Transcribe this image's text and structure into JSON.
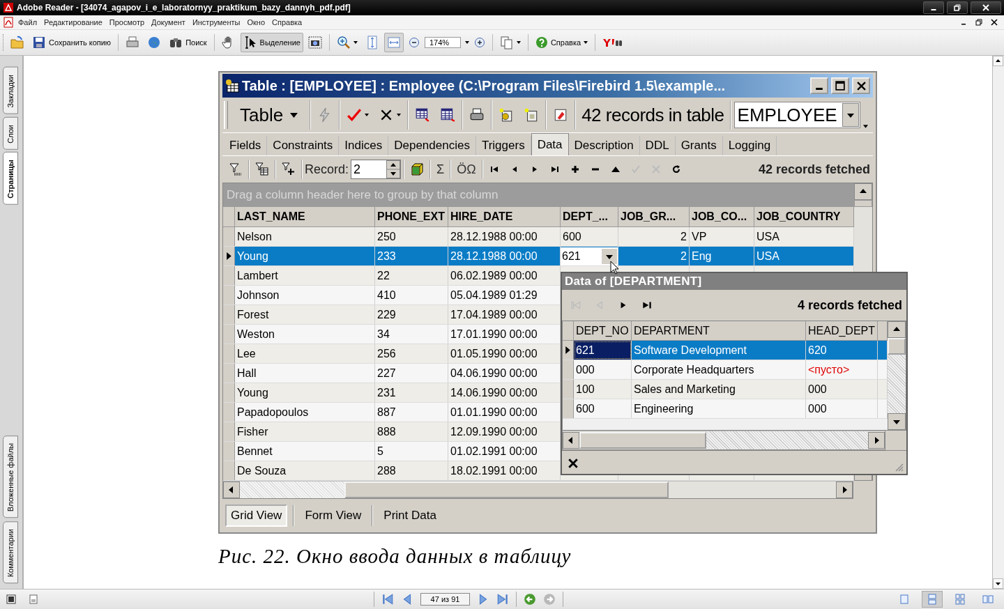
{
  "window": {
    "title": "Adobe Reader - [34074_agapov_i_e_laboratornyy_praktikum_bazy_dannyh_pdf.pdf]"
  },
  "menu": [
    "Файл",
    "Редактирование",
    "Просмотр",
    "Документ",
    "Инструменты",
    "Окно",
    "Справка"
  ],
  "toolbar": {
    "save_copy": "Сохранить копию",
    "search": "Поиск",
    "select_tool": {
      "label": "Выделение",
      "selected": true
    },
    "fit_width": {
      "selected": true
    },
    "zoom": "174%",
    "help": "Справка"
  },
  "side_tabs": [
    {
      "label": "Закладки",
      "selected": false
    },
    {
      "label": "Слои",
      "selected": false
    },
    {
      "label": "Страницы",
      "selected": true
    }
  ],
  "side_tabs_lower": [
    {
      "label": "Вложенные файлы",
      "selected": false
    },
    {
      "label": "Комментарии",
      "selected": false
    }
  ],
  "figure": {
    "title": "Table : [EMPLOYEE] : Employee (C:\\Program Files\\Firebird 1.5\\example...",
    "menu_button": "Table",
    "record_count": "42 records in table",
    "object_combo": "EMPLOYEE",
    "tabs": [
      {
        "label": "Fields",
        "selected": false
      },
      {
        "label": "Constraints",
        "selected": false
      },
      {
        "label": "Indices",
        "selected": false
      },
      {
        "label": "Dependencies",
        "selected": false
      },
      {
        "label": "Triggers",
        "selected": false
      },
      {
        "label": "Data",
        "selected": true
      },
      {
        "label": "Description",
        "selected": false
      },
      {
        "label": "DDL",
        "selected": false
      },
      {
        "label": "Grants",
        "selected": false
      },
      {
        "label": "Logging",
        "selected": false
      }
    ],
    "record_label": "Record:",
    "record_value": "2",
    "sum_symbol": "Σ",
    "charset_symbol": "ÖΩ",
    "fetched": "42 records fetched",
    "group_hint": "Drag a column header here to group by that column",
    "columns": [
      "LAST_NAME",
      "PHONE_EXT",
      "HIRE_DATE",
      "DEPT_...",
      "JOB_GR...",
      "JOB_CO...",
      "JOB_COUNTRY"
    ],
    "rows": [
      {
        "cells": [
          "Nelson",
          "250",
          "28.12.1988 00:00",
          "600",
          "2",
          "VP",
          "USA"
        ],
        "selected": false
      },
      {
        "cells": [
          "Young",
          "233",
          "28.12.1988 00:00",
          "621",
          "2",
          "Eng",
          "USA"
        ],
        "selected": true
      },
      {
        "cells": [
          "Lambert",
          "22",
          "06.02.1989 00:00"
        ],
        "selected": false
      },
      {
        "cells": [
          "Johnson",
          "410",
          "05.04.1989 01:29"
        ],
        "selected": false
      },
      {
        "cells": [
          "Forest",
          "229",
          "17.04.1989 00:00"
        ],
        "selected": false
      },
      {
        "cells": [
          "Weston",
          "34",
          "17.01.1990 00:00"
        ],
        "selected": false
      },
      {
        "cells": [
          "Lee",
          "256",
          "01.05.1990 00:00"
        ],
        "selected": false
      },
      {
        "cells": [
          "Hall",
          "227",
          "04.06.1990 00:00"
        ],
        "selected": false
      },
      {
        "cells": [
          "Young",
          "231",
          "14.06.1990 00:00"
        ],
        "selected": false
      },
      {
        "cells": [
          "Papadopoulos",
          "887",
          "01.01.1990 00:00"
        ],
        "selected": false
      },
      {
        "cells": [
          "Fisher",
          "888",
          "12.09.1990 00:00"
        ],
        "selected": false
      },
      {
        "cells": [
          "Bennet",
          "5",
          "01.02.1991 00:00"
        ],
        "selected": false
      },
      {
        "cells": [
          "De Souza",
          "288",
          "18.02.1991 00:00"
        ],
        "selected": false
      }
    ],
    "lookup": {
      "title": "Data of [DEPARTMENT]",
      "fetched": "4 records fetched",
      "columns": [
        "DEPT_NO",
        "DEPARTMENT",
        "HEAD_DEPT"
      ],
      "rows": [
        {
          "dept_no": "621",
          "department": "Software Development",
          "head_dept": "620",
          "head_dept_null": false,
          "selected": true
        },
        {
          "dept_no": "000",
          "department": "Corporate Headquarters",
          "head_dept": "<пусто>",
          "head_dept_null": true,
          "selected": false
        },
        {
          "dept_no": "100",
          "department": "Sales and Marketing",
          "head_dept": "000",
          "head_dept_null": false,
          "selected": false
        },
        {
          "dept_no": "600",
          "department": "Engineering",
          "head_dept": "000",
          "head_dept_null": false,
          "selected": false
        }
      ]
    },
    "view_tabs": [
      {
        "label": "Grid View",
        "selected": true
      },
      {
        "label": "Form View",
        "selected": false
      },
      {
        "label": "Print Data",
        "selected": false
      }
    ]
  },
  "caption": "Рис. 22. Окно ввода данных в таблицу",
  "status_bar": {
    "page": "47 из 91",
    "view_modes": [
      {
        "selected": false
      },
      {
        "selected": true
      },
      {
        "selected": false
      },
      {
        "selected": false
      }
    ]
  }
}
